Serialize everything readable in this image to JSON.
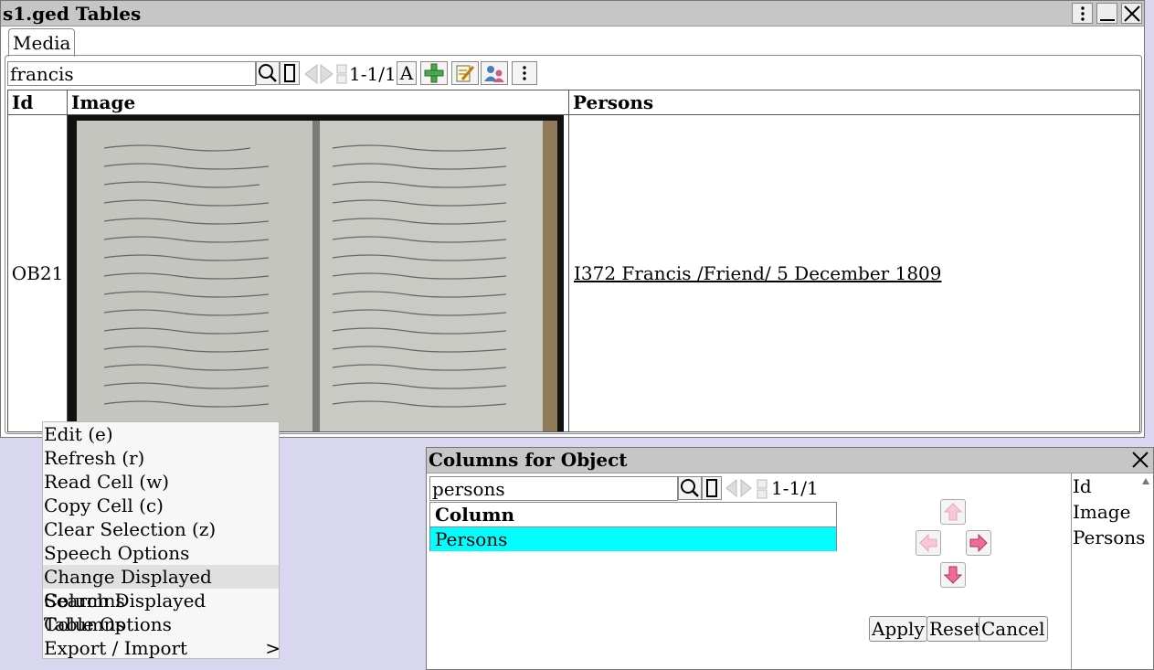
{
  "window": {
    "title": "s1.ged Tables",
    "tab": "Media",
    "search_value": "francis",
    "page_count": "1-1/1",
    "font_button": "A",
    "table": {
      "headers": [
        "Id",
        "Image",
        "Persons"
      ],
      "row": {
        "id": "OB21",
        "image_name": "register-book-icon",
        "persons_link": "I372 Francis /Friend/ 5 December 1809"
      }
    }
  },
  "context_menu": {
    "items": [
      {
        "label": "Edit (e)"
      },
      {
        "label": "Refresh (r)"
      },
      {
        "label": "Read Cell (w)"
      },
      {
        "label": "Copy Cell (c)"
      },
      {
        "label": "Clear Selection (z)"
      },
      {
        "label": "Speech Options"
      },
      {
        "label": "Change Displayed Columns"
      },
      {
        "label": "Search Displayed Columns"
      },
      {
        "label": "Table Options"
      },
      {
        "label": "Export / Import",
        "submenu": ">"
      }
    ]
  },
  "columns_dialog": {
    "title": "Columns for Object",
    "search_value": "persons",
    "page_count": "1-1/1",
    "list_header": "Column",
    "list_rows": [
      "Persons"
    ],
    "available": [
      "Id",
      "Image",
      "Persons"
    ],
    "buttons": {
      "apply": "Apply",
      "reset": "Reset",
      "cancel": "Cancel"
    }
  },
  "colors": {
    "selection": "#00ffff",
    "arrow_active": "#f06a9a",
    "arrow_inactive": "#f6c8d8"
  }
}
